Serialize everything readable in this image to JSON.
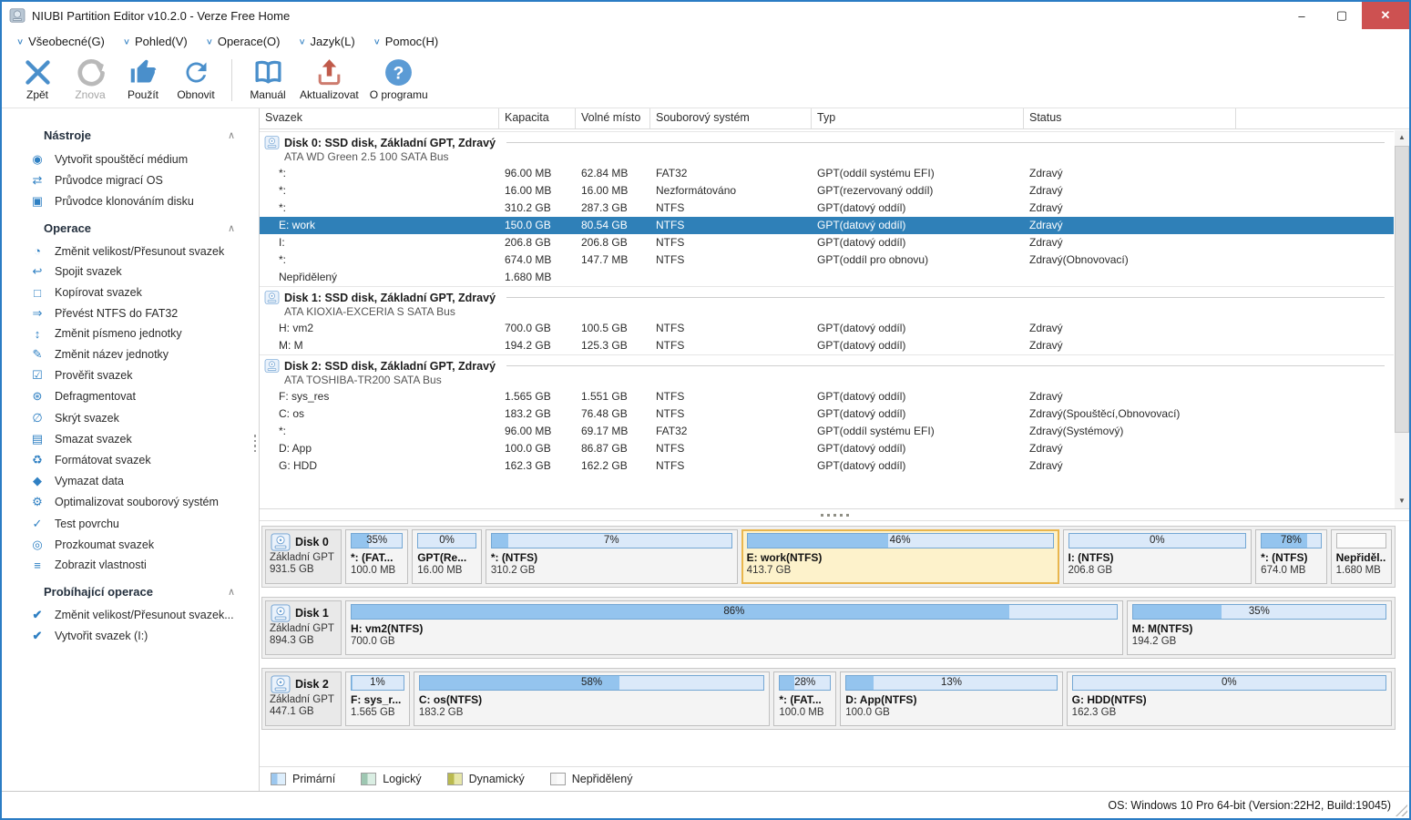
{
  "window": {
    "title": "NIUBI Partition Editor v10.2.0 - Verze Free Home",
    "controls": {
      "minimize": "–",
      "maximize": "▢",
      "close": "✕"
    }
  },
  "menu": {
    "items": [
      {
        "id": "vseobecne",
        "label": "Všeobecné(G)"
      },
      {
        "id": "pohled",
        "label": "Pohled(V)"
      },
      {
        "id": "operace",
        "label": "Operace(O)"
      },
      {
        "id": "jazyk",
        "label": "Jazyk(L)"
      },
      {
        "id": "pomoc",
        "label": "Pomoc(H)"
      }
    ]
  },
  "toolbar": {
    "buttons": [
      {
        "id": "zpet",
        "label": "Zpět",
        "icon": "undo",
        "color": "#4a8fcb",
        "disabled": false
      },
      {
        "id": "znova",
        "label": "Znova",
        "icon": "redo",
        "color": "#b9b9b9",
        "disabled": true
      },
      {
        "id": "pouzit",
        "label": "Použít",
        "icon": "thumb",
        "color": "#4a8fcb",
        "disabled": false
      },
      {
        "id": "obnovit",
        "label": "Obnovit",
        "icon": "refresh",
        "color": "#4a8fcb",
        "disabled": false,
        "sep_after": true
      },
      {
        "id": "manual",
        "label": "Manuál",
        "icon": "book",
        "color": "#4a8fcb",
        "disabled": false
      },
      {
        "id": "aktualizovat",
        "label": "Aktualizovat",
        "icon": "upload",
        "color": "#c05a4a",
        "disabled": false
      },
      {
        "id": "o-programu",
        "label": "O programu",
        "icon": "question",
        "color": "#5b9bd5",
        "disabled": false
      }
    ]
  },
  "sidebar": {
    "sections": [
      {
        "id": "nastroje",
        "title": "Nástroje",
        "items": [
          {
            "id": "boot-media",
            "icon": "boot-media-icon",
            "glyph": "◉",
            "label": "Vytvořit spouštěcí médium"
          },
          {
            "id": "os-migration",
            "icon": "os-migration-icon",
            "glyph": "⇄",
            "label": "Průvodce migrací OS"
          },
          {
            "id": "clone-disk",
            "icon": "clone-disk-icon",
            "glyph": "▣",
            "label": "Průvodce klonováním disku"
          }
        ]
      },
      {
        "id": "operace",
        "title": "Operace",
        "items": [
          {
            "id": "resize-move",
            "icon": "resize-move-icon",
            "glyph": "◔",
            "label": "Změnit velikost/Přesunout svazek"
          },
          {
            "id": "merge",
            "icon": "merge-volume-icon",
            "glyph": "↩",
            "label": "Spojit svazek"
          },
          {
            "id": "copy",
            "icon": "copy-volume-icon",
            "glyph": "□",
            "label": "Kopírovat svazek"
          },
          {
            "id": "convert",
            "icon": "convert-ntfs-icon",
            "glyph": "⇒",
            "label": "Převést NTFS do FAT32"
          },
          {
            "id": "drive-letter",
            "icon": "drive-letter-icon",
            "glyph": "↕",
            "label": "Změnit písmeno jednotky"
          },
          {
            "id": "rename",
            "icon": "rename-volume-icon",
            "glyph": "✎",
            "label": "Změnit název jednotky"
          },
          {
            "id": "check",
            "icon": "check-volume-icon",
            "glyph": "☑",
            "label": "Prověřit svazek"
          },
          {
            "id": "defrag",
            "icon": "defragment-icon",
            "glyph": "⊛",
            "label": "Defragmentovat"
          },
          {
            "id": "hide",
            "icon": "hide-volume-icon",
            "glyph": "∅",
            "label": "Skrýt svazek"
          },
          {
            "id": "delete",
            "icon": "delete-volume-icon",
            "glyph": "▤",
            "label": "Smazat svazek"
          },
          {
            "id": "format",
            "icon": "format-volume-icon",
            "glyph": "♻",
            "label": "Formátovat svazek"
          },
          {
            "id": "wipe",
            "icon": "wipe-data-icon",
            "glyph": "◆",
            "label": "Vymazat data"
          },
          {
            "id": "optimize",
            "icon": "optimize-fs-icon",
            "glyph": "⚙",
            "label": "Optimalizovat souborový systém"
          },
          {
            "id": "surface-test",
            "icon": "surface-test-icon",
            "glyph": "✓",
            "label": "Test povrchu"
          },
          {
            "id": "explore",
            "icon": "explore-volume-icon",
            "glyph": "◎",
            "label": "Prozkoumat svazek"
          },
          {
            "id": "properties",
            "icon": "properties-icon",
            "glyph": "≡",
            "label": "Zobrazit vlastnosti"
          }
        ]
      },
      {
        "id": "probihajici-operace",
        "title": "Probíhající operace",
        "items": [
          {
            "id": "pending-resize",
            "icon": "check-done-icon",
            "glyph": "✔",
            "label": "Změnit velikost/Přesunout svazek..."
          },
          {
            "id": "pending-create",
            "icon": "check-done-icon",
            "glyph": "✔",
            "label": "Vytvořit svazek (I:)"
          }
        ]
      }
    ],
    "collapse_glyph": "∧"
  },
  "table": {
    "columns": [
      "Svazek",
      "Kapacita",
      "Volné místo",
      "Souborový systém",
      "Typ",
      "Status",
      ""
    ],
    "groups": [
      {
        "title": "Disk 0: SSD disk, Základní GPT, Zdravý",
        "subtitle": "ATA WD Green 2.5 100 SATA Bus",
        "rows": [
          {
            "cells": [
              "*:",
              "96.00 MB",
              "62.84 MB",
              "FAT32",
              "GPT(oddíl systému EFI)",
              "Zdravý"
            ],
            "selected": false
          },
          {
            "cells": [
              "*:",
              "16.00 MB",
              "16.00 MB",
              "Nezformátováno",
              "GPT(rezervovaný oddíl)",
              "Zdravý"
            ],
            "selected": false
          },
          {
            "cells": [
              "*:",
              "310.2 GB",
              "287.3 GB",
              "NTFS",
              "GPT(datový oddíl)",
              "Zdravý"
            ],
            "selected": false
          },
          {
            "cells": [
              "E: work",
              "150.0 GB",
              "80.54 GB",
              "NTFS",
              "GPT(datový oddíl)",
              "Zdravý"
            ],
            "selected": true
          },
          {
            "cells": [
              "I:",
              "206.8 GB",
              "206.8 GB",
              "NTFS",
              "GPT(datový oddíl)",
              "Zdravý"
            ],
            "selected": false
          },
          {
            "cells": [
              "*:",
              "674.0 MB",
              "147.7 MB",
              "NTFS",
              "GPT(oddíl pro obnovu)",
              "Zdravý(Obnovovací)"
            ],
            "selected": false
          },
          {
            "cells": [
              "Nepřidělený",
              "1.680 MB",
              "",
              "",
              "",
              ""
            ],
            "selected": false
          }
        ]
      },
      {
        "title": "Disk 1: SSD disk, Základní GPT, Zdravý",
        "subtitle": "ATA KIOXIA-EXCERIA S SATA Bus",
        "rows": [
          {
            "cells": [
              "H: vm2",
              "700.0 GB",
              "100.5 GB",
              "NTFS",
              "GPT(datový oddíl)",
              "Zdravý"
            ],
            "selected": false
          },
          {
            "cells": [
              "M: M",
              "194.2 GB",
              "125.3 GB",
              "NTFS",
              "GPT(datový oddíl)",
              "Zdravý"
            ],
            "selected": false
          }
        ]
      },
      {
        "title": "Disk 2: SSD disk, Základní GPT, Zdravý",
        "subtitle": "ATA TOSHIBA-TR200 SATA Bus",
        "rows": [
          {
            "cells": [
              "F: sys_res",
              "1.565 GB",
              "1.551 GB",
              "NTFS",
              "GPT(datový oddíl)",
              "Zdravý"
            ],
            "selected": false
          },
          {
            "cells": [
              "C: os",
              "183.2 GB",
              "76.48 GB",
              "NTFS",
              "GPT(datový oddíl)",
              "Zdravý(Spouštěcí,Obnovovací)"
            ],
            "selected": false
          },
          {
            "cells": [
              "*:",
              "96.00 MB",
              "69.17 MB",
              "FAT32",
              "GPT(oddíl systému EFI)",
              "Zdravý(Systémový)"
            ],
            "selected": false
          },
          {
            "cells": [
              "D: App",
              "100.0 GB",
              "86.87 GB",
              "NTFS",
              "GPT(datový oddíl)",
              "Zdravý"
            ],
            "selected": false
          },
          {
            "cells": [
              "G: HDD",
              "162.3 GB",
              "162.2 GB",
              "NTFS",
              "GPT(datový oddíl)",
              "Zdravý"
            ],
            "selected": false
          }
        ]
      }
    ]
  },
  "disks": [
    {
      "name": "Disk 0",
      "scheme": "Základní GPT",
      "size": "931.5 GB",
      "partitions": [
        {
          "label": "*: (FAT...",
          "size": "100.0 MB",
          "percent": "35%",
          "fill": 35,
          "flex": 62,
          "state": "normal"
        },
        {
          "label": "GPT(Re...",
          "size": "16.00 MB",
          "percent": "0%",
          "fill": 0,
          "flex": 70,
          "state": "normal"
        },
        {
          "label": "*: (NTFS)",
          "size": "310.2 GB",
          "percent": "7%",
          "fill": 7,
          "flex": 287,
          "state": "normal"
        },
        {
          "label": "E: work(NTFS)",
          "size": "413.7 GB",
          "percent": "46%",
          "fill": 46,
          "flex": 365,
          "state": "selected"
        },
        {
          "label": "I: (NTFS)",
          "size": "206.8 GB",
          "percent": "0%",
          "fill": 0,
          "flex": 212,
          "state": "normal"
        },
        {
          "label": "*: (NTFS)",
          "size": "674.0 MB",
          "percent": "78%",
          "fill": 78,
          "flex": 72,
          "state": "normal"
        },
        {
          "label": "Nepřiděl...",
          "size": "1.680 MB",
          "percent": "",
          "fill": 0,
          "flex": 60,
          "state": "unallocated"
        }
      ]
    },
    {
      "name": "Disk 1",
      "scheme": "Základní GPT",
      "size": "894.3 GB",
      "partitions": [
        {
          "label": "H: vm2(NTFS)",
          "size": "700.0 GB",
          "percent": "86%",
          "fill": 86,
          "flex": 868,
          "state": "normal"
        },
        {
          "label": "M: M(NTFS)",
          "size": "194.2 GB",
          "percent": "35%",
          "fill": 35,
          "flex": 288,
          "state": "normal"
        }
      ]
    },
    {
      "name": "Disk 2",
      "scheme": "Základní GPT",
      "size": "447.1 GB",
      "partitions": [
        {
          "label": "F: sys_r...",
          "size": "1.565 GB",
          "percent": "1%",
          "fill": 1,
          "flex": 62,
          "state": "normal"
        },
        {
          "label": "C: os(NTFS)",
          "size": "183.2 GB",
          "percent": "58%",
          "fill": 58,
          "flex": 400,
          "state": "normal"
        },
        {
          "label": "*: (FAT...",
          "size": "100.0 MB",
          "percent": "28%",
          "fill": 28,
          "flex": 60,
          "state": "normal"
        },
        {
          "label": "D: App(NTFS)",
          "size": "100.0 GB",
          "percent": "13%",
          "fill": 13,
          "flex": 245,
          "state": "normal"
        },
        {
          "label": "G: HDD(NTFS)",
          "size": "162.3 GB",
          "percent": "0%",
          "fill": 0,
          "flex": 364,
          "state": "normal"
        }
      ]
    }
  ],
  "legend": {
    "items": [
      {
        "label": "Primární",
        "edge": "#9cc7ee",
        "bg": "#ddeefc"
      },
      {
        "label": "Logický",
        "edge": "#9ec7b2",
        "bg": "#daeee3"
      },
      {
        "label": "Dynamický",
        "edge": "#b9b94e",
        "bg": "#e6e6a8"
      },
      {
        "label": "Nepřidělený",
        "edge": "#f4f4f4",
        "bg": "#fbfbfb"
      }
    ]
  },
  "statusbar": {
    "os_info": "OS: Windows 10 Pro 64-bit (Version:22H2, Build:19045)"
  },
  "colors": {
    "accent_blue": "#3a85c5",
    "selected_row": "#2f80b8",
    "selection_bg": "#fdf2cb",
    "selection_border": "#e9b64d",
    "bar_fill": "#94c4ee",
    "bar_track": "#dbe9f9",
    "update_red": "#c05a4a",
    "window_border": "#2b7cc4",
    "close_button": "#cd5151"
  }
}
